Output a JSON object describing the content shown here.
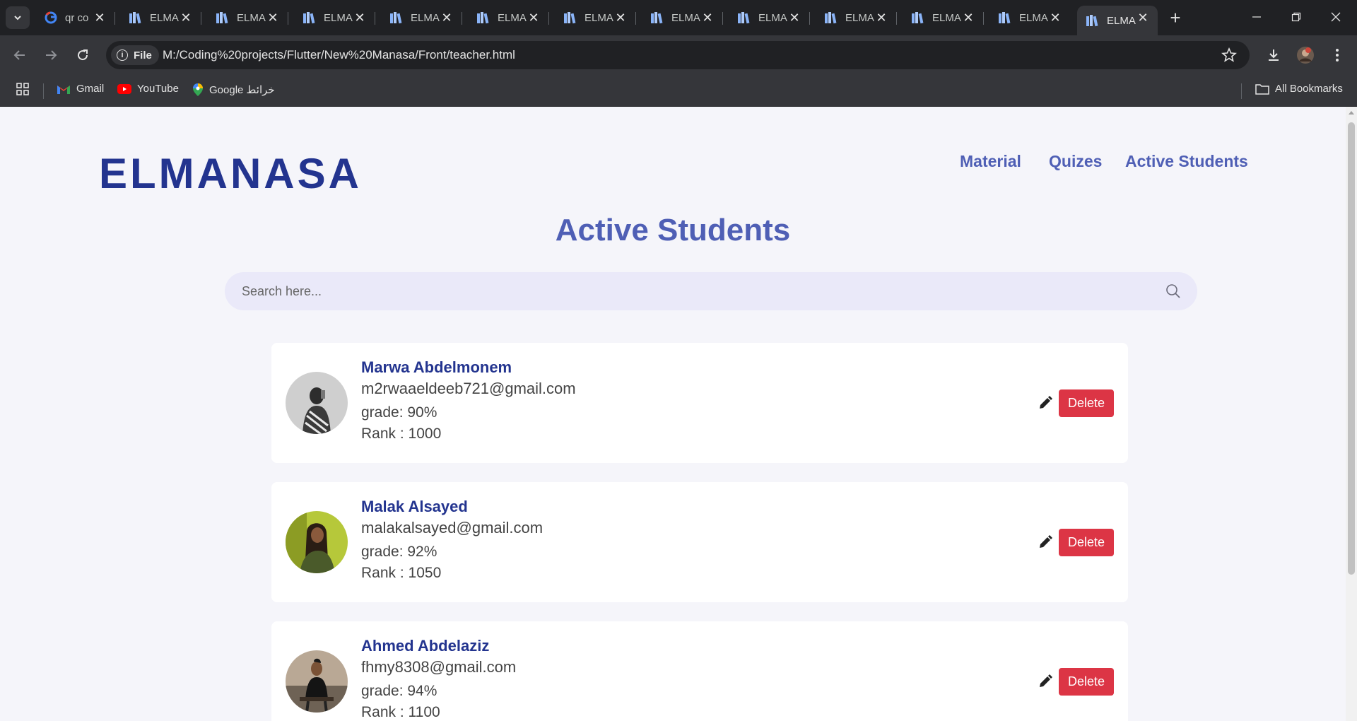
{
  "browser": {
    "tabs": [
      {
        "title": "qr co",
        "favicon": "google-icon"
      },
      {
        "title": "ELMA",
        "favicon": "books-icon"
      },
      {
        "title": "ELMA",
        "favicon": "books-icon"
      },
      {
        "title": "ELMA",
        "favicon": "books-icon"
      },
      {
        "title": "ELMA",
        "favicon": "books-icon"
      },
      {
        "title": "ELMA",
        "favicon": "books-icon"
      },
      {
        "title": "ELMA",
        "favicon": "books-icon"
      },
      {
        "title": "ELMA",
        "favicon": "books-icon"
      },
      {
        "title": "ELMA",
        "favicon": "books-icon"
      },
      {
        "title": "ELMA",
        "favicon": "books-icon"
      },
      {
        "title": "ELMA",
        "favicon": "books-icon"
      },
      {
        "title": "ELMA",
        "favicon": "books-icon"
      },
      {
        "title": "ELMA",
        "favicon": "books-icon",
        "active": true
      }
    ],
    "url_chip": "File",
    "url": "M:/Coding%20projects/Flutter/New%20Manasa/Front/teacher.html",
    "bookmarks": [
      {
        "label": "Gmail",
        "icon": "gmail-icon"
      },
      {
        "label": "YouTube",
        "icon": "youtube-icon"
      },
      {
        "label": "Google خرائط",
        "icon": "maps-icon"
      }
    ],
    "all_bookmarks": "All Bookmarks"
  },
  "page": {
    "brand": "ELMANASA",
    "nav": [
      "Material",
      "Quizes",
      "Active Students"
    ],
    "title": "Active Students",
    "search_placeholder": "Search here...",
    "students": [
      {
        "name": "Marwa Abdelmonem",
        "email": "m2rwaaeldeeb721@gmail.com",
        "grade": "grade: 90%",
        "rank": "Rank : 1000",
        "action": "Delete"
      },
      {
        "name": "Malak Alsayed",
        "email": "malakalsayed@gmail.com",
        "grade": "grade: 92%",
        "rank": "Rank : 1050",
        "action": "Delete"
      },
      {
        "name": "Ahmed Abdelaziz",
        "email": "fhmy8308@gmail.com",
        "grade": "grade: 94%",
        "rank": "Rank : 1100",
        "action": "Delete"
      }
    ]
  },
  "colors": {
    "brand": "#23348f",
    "nav": "#4f5fb5",
    "delete": "#dc3545",
    "page_bg": "#f5f5fa",
    "search_bg": "#eae9f9"
  }
}
